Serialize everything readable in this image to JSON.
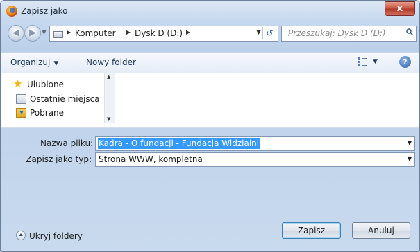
{
  "window": {
    "title": "Zapisz jako",
    "close_glyph": "x"
  },
  "nav": {
    "breadcrumbs": [
      "Komputer",
      "Dysk D (D:)"
    ],
    "search_placeholder": "Przeszukaj: Dysk D (D:)"
  },
  "toolbar": {
    "organize": "Organizuj",
    "new_folder": "Nowy folder",
    "help_glyph": "?"
  },
  "navpane": {
    "items": [
      {
        "label": "Ulubione",
        "icon": "star-icon"
      },
      {
        "label": "Ostatnie miejsca",
        "icon": "recent-places-icon"
      },
      {
        "label": "Pobrane",
        "icon": "downloads-icon"
      }
    ]
  },
  "form": {
    "filename_label": "Nazwa pliku:",
    "filename_value": "Kadra - O fundacji - Fundacja Widzialni",
    "type_label": "Zapisz jako typ:",
    "type_value": "Strona WWW, kompletna"
  },
  "footer": {
    "hide_folders": "Ukryj foldery",
    "save": "Zapisz",
    "cancel": "Anuluj"
  },
  "colors": {
    "selection": "#3399ff",
    "close": "#c75543",
    "toolbar_text": "#1e395b"
  }
}
